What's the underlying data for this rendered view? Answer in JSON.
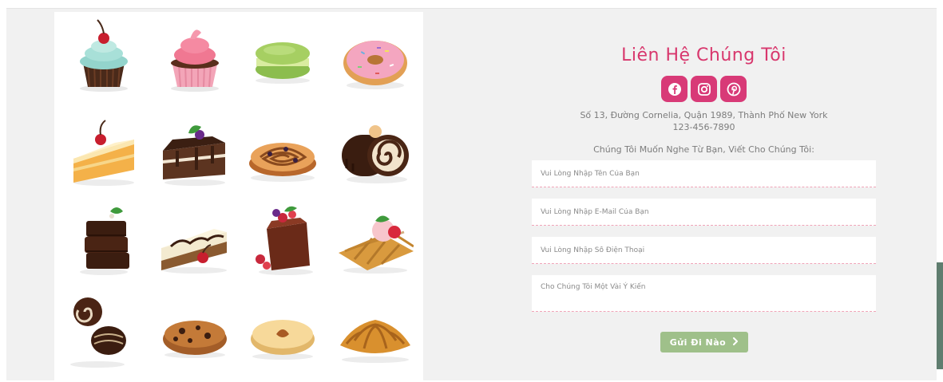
{
  "gallery": {
    "items": [
      {
        "name": "cherry cupcake",
        "icon": "cupcake-cherry-icon"
      },
      {
        "name": "pink cupcake",
        "icon": "cupcake-pink-icon"
      },
      {
        "name": "macaron",
        "icon": "macaron-icon"
      },
      {
        "name": "donut",
        "icon": "donut-icon"
      },
      {
        "name": "cherry cake slice",
        "icon": "cake-slice-cherry-icon"
      },
      {
        "name": "chocolate cake slice",
        "icon": "cake-slice-chocolate-icon"
      },
      {
        "name": "cinnamon roll",
        "icon": "cinnamon-roll-icon"
      },
      {
        "name": "chocolate swiss roll",
        "icon": "swiss-roll-icon"
      },
      {
        "name": "brownie stack",
        "icon": "brownie-icon"
      },
      {
        "name": "cheesecake",
        "icon": "cheesecake-icon"
      },
      {
        "name": "berry cake",
        "icon": "berry-cake-icon"
      },
      {
        "name": "waffle",
        "icon": "waffle-icon"
      },
      {
        "name": "chocolate candies",
        "icon": "chocolate-candy-icon"
      },
      {
        "name": "cookie",
        "icon": "cookie-icon"
      },
      {
        "name": "jam cookie",
        "icon": "jam-cookie-icon"
      },
      {
        "name": "croissant",
        "icon": "croissant-icon"
      }
    ]
  },
  "contact": {
    "title": "Liên Hệ Chúng Tôi",
    "socials": [
      {
        "name": "facebook",
        "icon": "facebook-icon"
      },
      {
        "name": "instagram",
        "icon": "instagram-icon"
      },
      {
        "name": "pinterest",
        "icon": "pinterest-icon"
      }
    ],
    "address": "Số 13, Đường Cornelia, Quận 1989, Thành Phố New York",
    "phone": "123-456-7890",
    "prompt": "Chúng Tôi Muốn Nghe Từ Bạn, Viết Cho Chúng Tôi:",
    "fields": {
      "name_placeholder": "Vui Lòng Nhập Tên Của Bạn",
      "email_placeholder": "Vui Lòng Nhập E-Mail Của Bạn",
      "phone_placeholder": "Vui Lòng Nhập Số Điện Thoại",
      "message_placeholder": "Cho Chúng Tôi Một Vài Ý Kiến"
    },
    "submit_label": "Gửi Đi Nào",
    "submit_icon": "chevron-right-icon"
  },
  "colors": {
    "accent": "#d83a77",
    "title": "#d8376d",
    "submit": "#9fc08a",
    "side_tab": "#5f7d6f"
  }
}
